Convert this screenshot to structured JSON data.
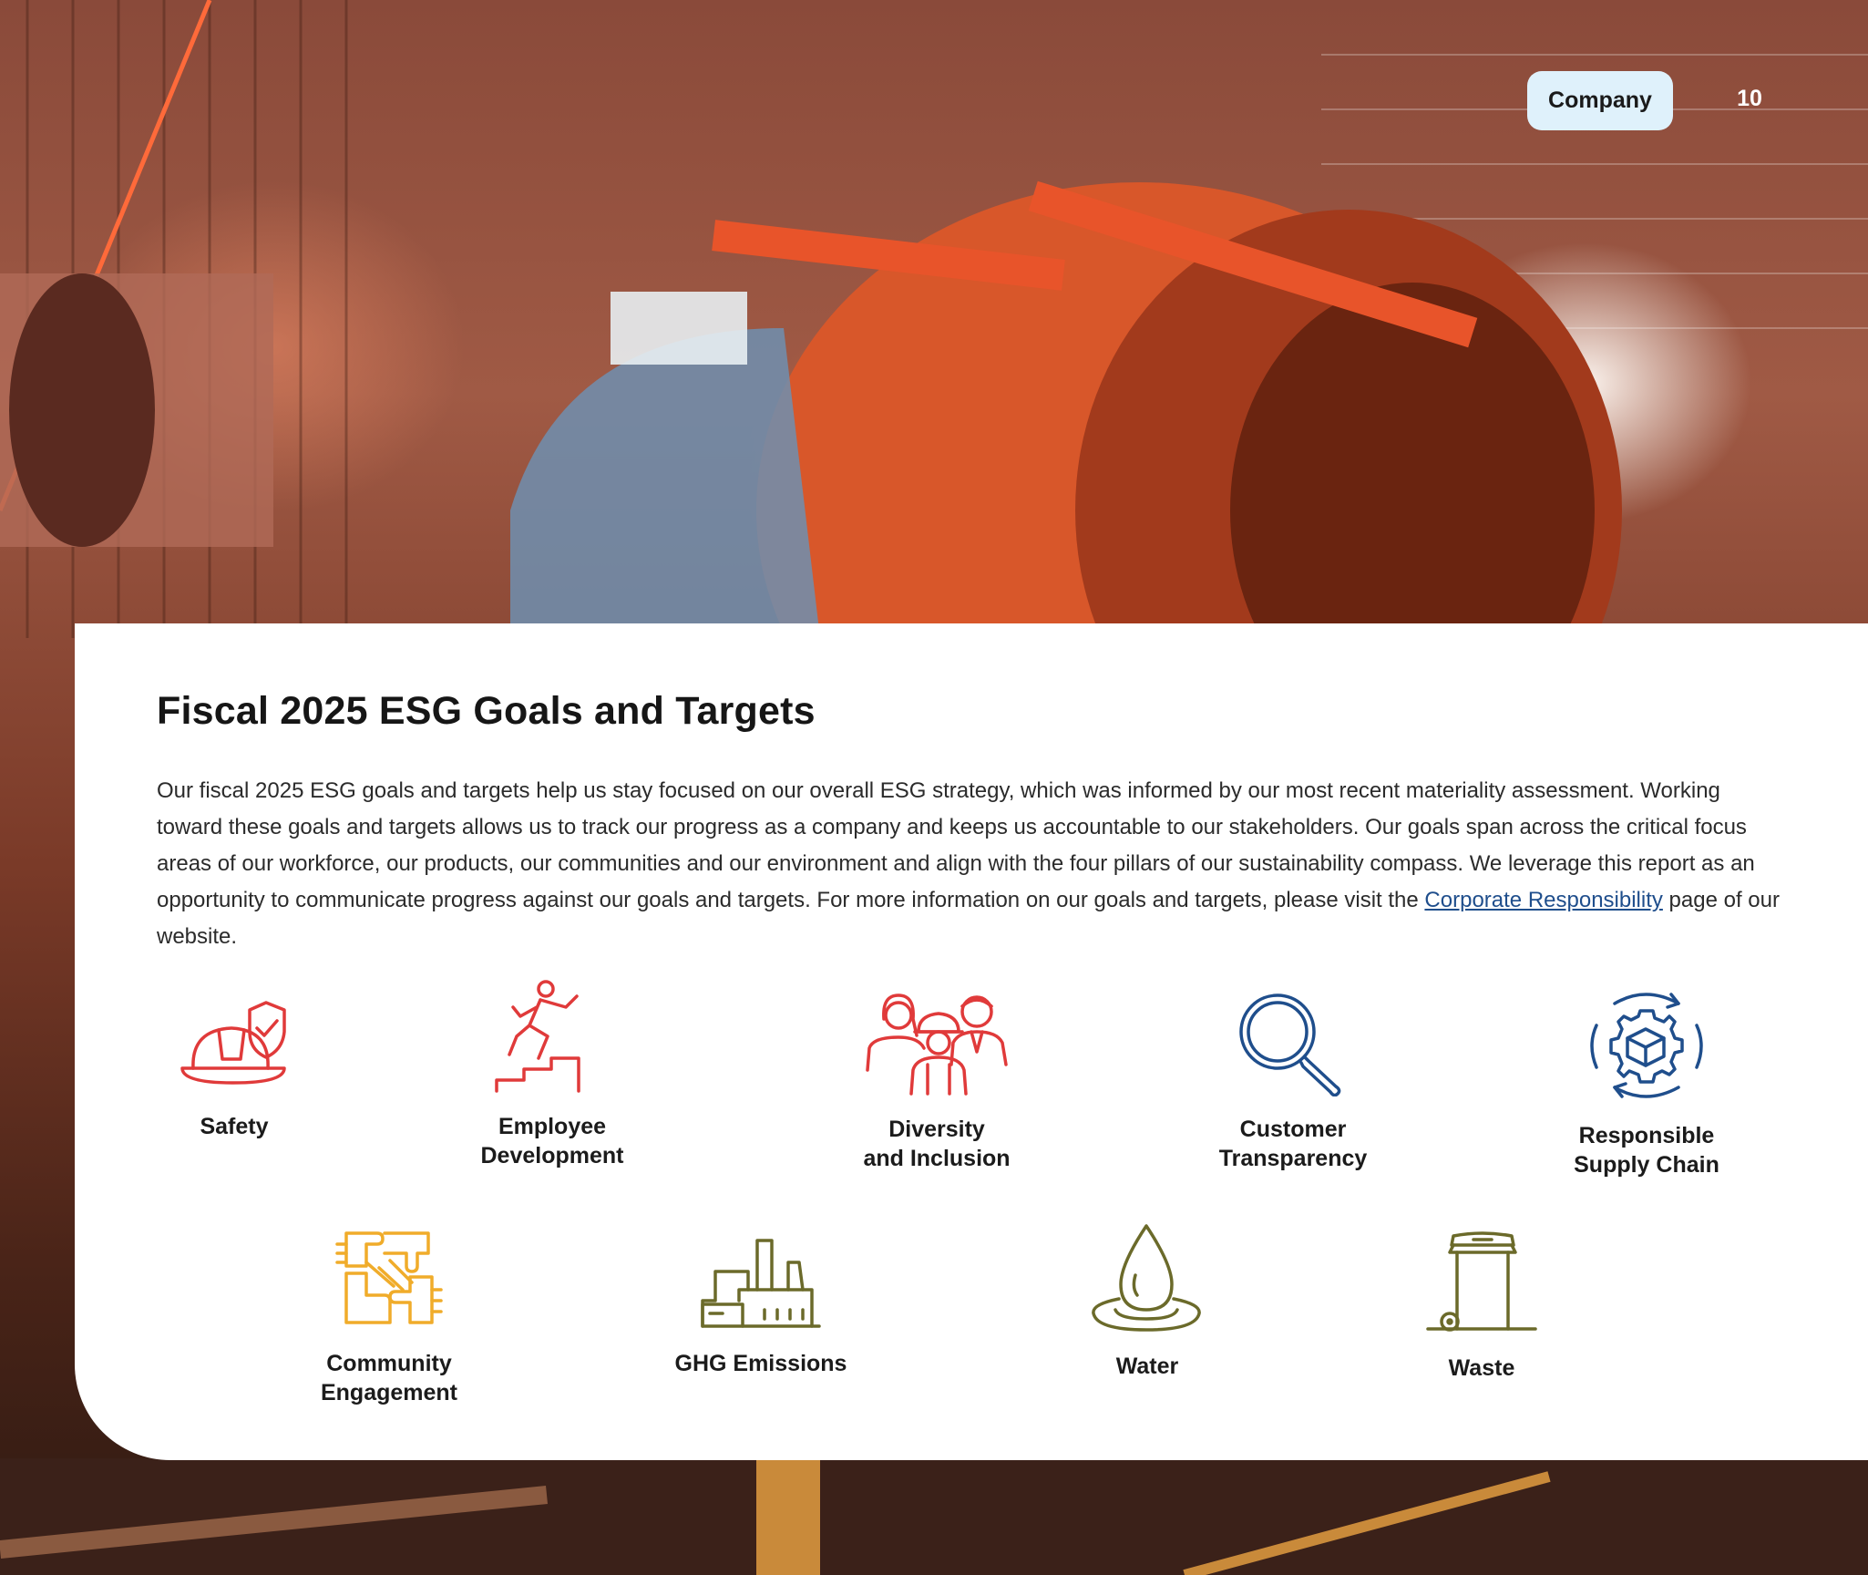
{
  "header": {
    "section_label": "Company",
    "page_number": "10"
  },
  "content": {
    "title": "Fiscal 2025 ESG Goals and Targets",
    "intro_text": "Our fiscal 2025 ESG goals and targets help us stay focused on our overall ESG strategy, which was informed by our most recent materiality assessment. Working toward these goals and targets allows us to track our progress as a company and keeps us accountable to our stakeholders. Our goals span across the critical focus areas of our workforce, our products, our communities and our environment and align with the four pillars of our sustainability compass. We leverage this report as an opportunity to communicate progress against our goals and targets. For more information on our goals and targets, please visit the ",
    "link_text": "Corporate Responsibility",
    "intro_suffix": " page of our website."
  },
  "goals": [
    {
      "label": "Safety",
      "icon": "hardhat-shield-icon",
      "color": "#e03a3a"
    },
    {
      "label": "Employee\nDevelopment",
      "icon": "runner-stairs-icon",
      "color": "#e03a3a"
    },
    {
      "label": "Diversity\nand Inclusion",
      "icon": "diverse-people-icon",
      "color": "#e03a3a"
    },
    {
      "label": "Customer\nTransparency",
      "icon": "magnifier-icon",
      "color": "#1f4e8c"
    },
    {
      "label": "Responsible\nSupply Chain",
      "icon": "gear-cube-cycle-icon",
      "color": "#1f4e8c"
    },
    {
      "label": "Community\nEngagement",
      "icon": "joined-hands-icon",
      "color": "#f0ac2a"
    },
    {
      "label": "GHG Emissions",
      "icon": "factory-icon",
      "color": "#6b6a2a"
    },
    {
      "label": "Water",
      "icon": "water-drop-icon",
      "color": "#6b6a2a"
    },
    {
      "label": "Waste",
      "icon": "waste-bin-icon",
      "color": "#6b6a2a"
    }
  ]
}
